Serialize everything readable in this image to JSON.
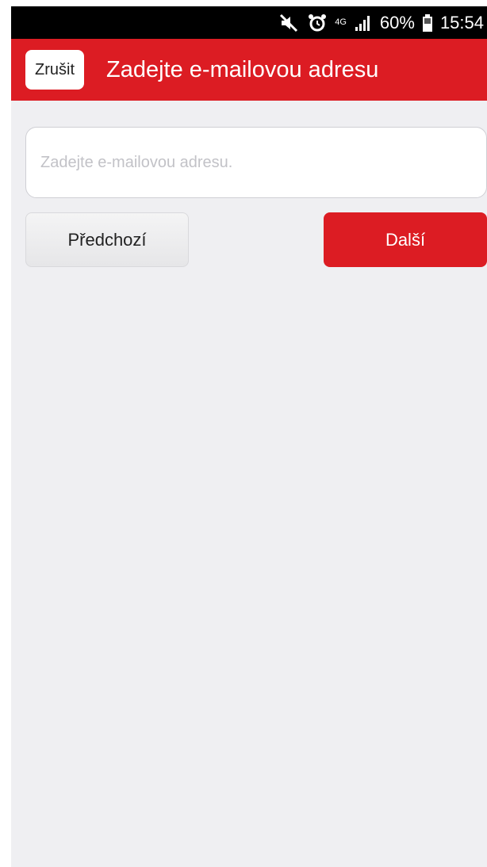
{
  "status_bar": {
    "icons": [
      "mute-icon",
      "alarm-icon",
      "network-4g-icon",
      "signal-icon",
      "battery-icon"
    ],
    "network_label": "4G",
    "battery": "60%",
    "time": "15:54"
  },
  "app_bar": {
    "cancel_label": "Zrušit",
    "title": "Zadejte e-mailovou adresu"
  },
  "form": {
    "email_placeholder": "Zadejte e-mailovou adresu.",
    "email_value": "",
    "previous_label": "Předchozí",
    "next_label": "Další"
  },
  "colors": {
    "accent": "#dc1c23",
    "background": "#efeff2"
  }
}
